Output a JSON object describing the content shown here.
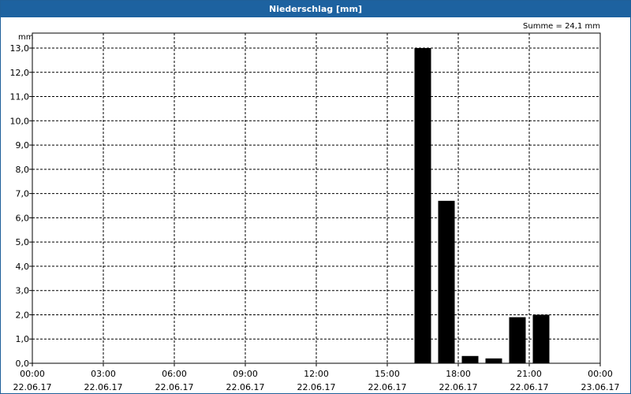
{
  "window": {
    "title": "Niederschlag [mm]"
  },
  "colors": {
    "title_bar": "#1d62a0",
    "bars": "#000000",
    "grid": "#000000"
  },
  "chart_data": {
    "type": "bar",
    "ylabel": "mm",
    "annotation": "Summe = 24,1 mm",
    "ylim": [
      0,
      13
    ],
    "y_ticks": [
      "0,0",
      "1,0",
      "2,0",
      "3,0",
      "4,0",
      "5,0",
      "6,0",
      "7,0",
      "8,0",
      "9,0",
      "10,0",
      "11,0",
      "12,0",
      "13,0"
    ],
    "x_ticks": [
      {
        "time": "00:00",
        "date": "22.06.17"
      },
      {
        "time": "03:00",
        "date": "22.06.17"
      },
      {
        "time": "06:00",
        "date": "22.06.17"
      },
      {
        "time": "09:00",
        "date": "22.06.17"
      },
      {
        "time": "12:00",
        "date": "22.06.17"
      },
      {
        "time": "15:00",
        "date": "22.06.17"
      },
      {
        "time": "18:00",
        "date": "22.06.17"
      },
      {
        "time": "21:00",
        "date": "22.06.17"
      },
      {
        "time": "00:00",
        "date": "23.06.17"
      }
    ],
    "xlim": [
      "22.06.17 00:00",
      "23.06.17 00:00"
    ],
    "grid": true,
    "bars": [
      {
        "time": "22.06.17 16:30",
        "value": 13.0
      },
      {
        "time": "22.06.17 17:30",
        "value": 6.7
      },
      {
        "time": "22.06.17 18:30",
        "value": 0.3
      },
      {
        "time": "22.06.17 19:30",
        "value": 0.2
      },
      {
        "time": "22.06.17 20:30",
        "value": 1.9
      },
      {
        "time": "22.06.17 21:30",
        "value": 2.0
      }
    ]
  }
}
